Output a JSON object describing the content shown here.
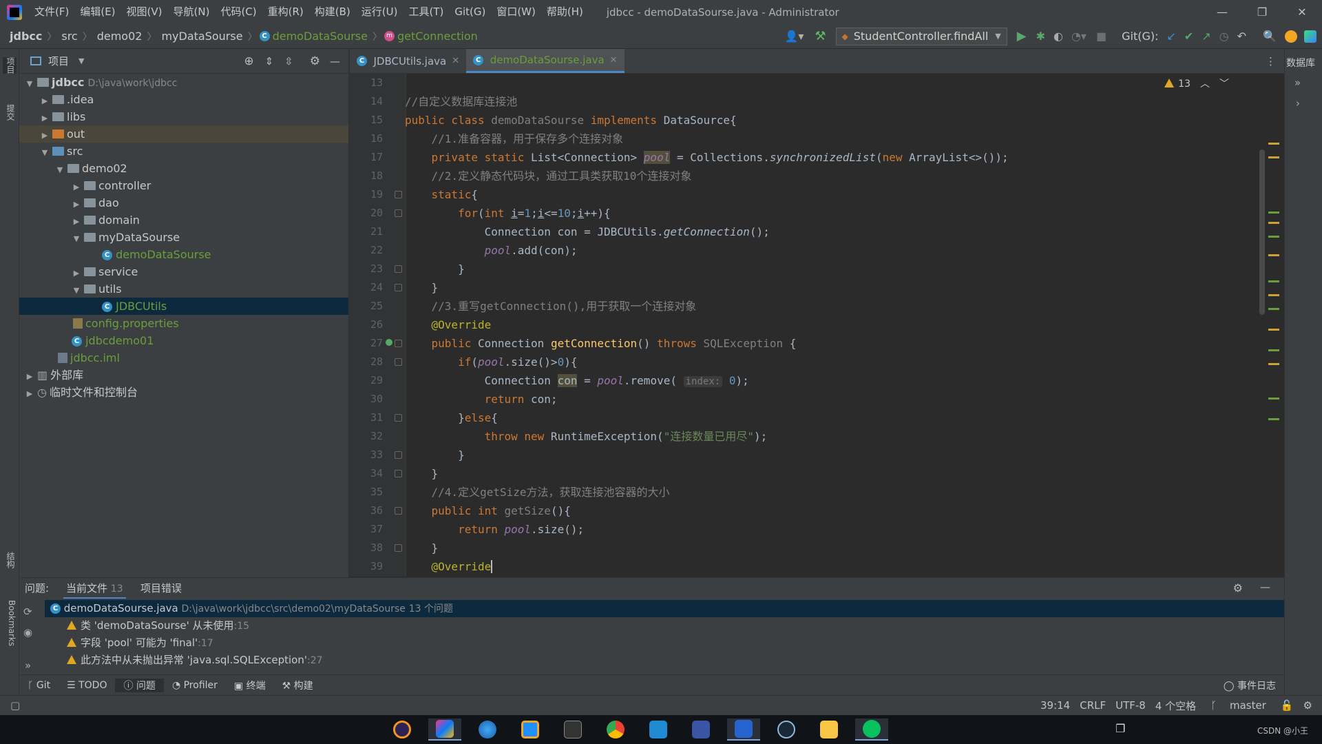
{
  "menu": {
    "items": [
      "文件(F)",
      "编辑(E)",
      "视图(V)",
      "导航(N)",
      "代码(C)",
      "重构(R)",
      "构建(B)",
      "运行(U)",
      "工具(T)",
      "Git(G)",
      "窗口(W)",
      "帮助(H)"
    ],
    "title": "jdbcc - demoDataSourse.java - Administrator"
  },
  "nav": {
    "crumbs": [
      "jdbcc",
      "src",
      "demo02",
      "myDataSourse"
    ],
    "file": "demoDataSourse",
    "method": "getConnection",
    "run_config": "StudentController.findAll",
    "git_label": "Git(G):"
  },
  "project": {
    "header": "项目",
    "rows": [
      {
        "label": "jdbcc",
        "extra": "D:\\java\\work\\jdbcc"
      },
      {
        "label": ".idea"
      },
      {
        "label": "libs"
      },
      {
        "label": "out"
      },
      {
        "label": "src"
      },
      {
        "label": "demo02"
      },
      {
        "label": "controller"
      },
      {
        "label": "dao"
      },
      {
        "label": "domain"
      },
      {
        "label": "myDataSourse"
      },
      {
        "label": "demoDataSourse"
      },
      {
        "label": "service"
      },
      {
        "label": "utils"
      },
      {
        "label": "JDBCUtils"
      },
      {
        "label": "config.properties"
      },
      {
        "label": "jdbcdemo01"
      },
      {
        "label": "jdbcc.iml"
      },
      {
        "label": "外部库"
      },
      {
        "label": "临时文件和控制台"
      }
    ]
  },
  "left_strip": {
    "project": "项目",
    "commit": "提交",
    "structure": "结构",
    "bookmarks": "Bookmarks"
  },
  "right_strip": {
    "db": "数据库"
  },
  "tabs": [
    {
      "label": "JDBCUtils.java"
    },
    {
      "label": "demoDataSourse.java"
    }
  ],
  "editor": {
    "warning_count": "13",
    "line_numbers": [
      "13",
      "14",
      "15",
      "16",
      "17",
      "18",
      "19",
      "20",
      "21",
      "22",
      "23",
      "24",
      "25",
      "26",
      "27",
      "28",
      "29",
      "30",
      "31",
      "32",
      "33",
      "34",
      "35",
      "36",
      "37",
      "38",
      "39"
    ],
    "hint_index": "index:",
    "comments": {
      "c14": "//自定义数据库连接池",
      "c16": "//1.准备容器，用于保存多个连接对象",
      "c18": "//2.定义静态代码块，通过工具类获取10个连接对象",
      "c25": "//3.重写getConnection(),用于获取一个连接对象",
      "c35": "//4.定义getSize方法，获取连接池容器的大小"
    },
    "str32": "\"连接数量已用尽\""
  },
  "problems": {
    "label": "问题:",
    "tab_current": "当前文件",
    "tab_current_count": "13",
    "tab_project": "项目错误",
    "file": "demoDataSourse.java",
    "path": "D:\\java\\work\\jdbcc\\src\\demo02\\myDataSourse",
    "summary": "13 个问题",
    "items": [
      {
        "text": "类 'demoDataSourse' 从未使用",
        "line": ":15"
      },
      {
        "text": "字段 'pool' 可能为 'final'",
        "line": ":17"
      },
      {
        "text": "此方法中从未抛出异常 'java.sql.SQLException'",
        "line": ":27"
      }
    ]
  },
  "bottom_tools": [
    "Git",
    "TODO",
    "问题",
    "Profiler",
    "终端",
    "构建"
  ],
  "event_log": "事件日志",
  "status": {
    "position": "39:14",
    "line_sep": "CRLF",
    "encoding": "UTF-8",
    "indent": "4 个空格",
    "branch": "master"
  },
  "taskbar": {
    "watermark": "CSDN @小王"
  },
  "colors": {
    "accent": "#4a88c7",
    "keyword": "#cc7832",
    "comment": "#808080",
    "function": "#ffc66d",
    "string": "#6a8759",
    "warning": "#e0a822"
  }
}
